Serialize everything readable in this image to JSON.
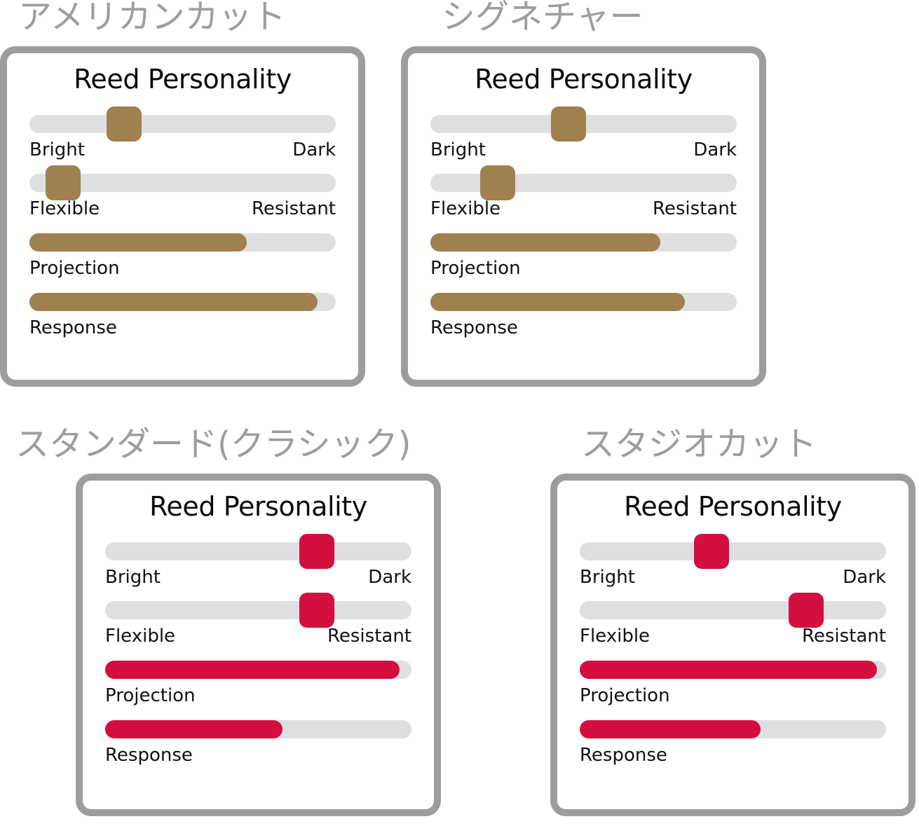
{
  "cards": [
    {
      "heading": "アメリカンカット",
      "title": "Reed Personality",
      "accent": "#a0804f",
      "controls": [
        {
          "type": "thumb",
          "value": 31,
          "left_label": "Bright",
          "right_label": "Dark"
        },
        {
          "type": "thumb",
          "value": 11,
          "left_label": "Flexible",
          "right_label": "Resistant"
        },
        {
          "type": "fill",
          "value": 71,
          "left_label": "Projection",
          "right_label": ""
        },
        {
          "type": "fill",
          "value": 94,
          "left_label": "Response",
          "right_label": ""
        }
      ]
    },
    {
      "heading": "シグネチャー",
      "title": "Reed Personality",
      "accent": "#a0804f",
      "controls": [
        {
          "type": "thumb",
          "value": 45,
          "left_label": "Bright",
          "right_label": "Dark"
        },
        {
          "type": "thumb",
          "value": 22,
          "left_label": "Flexible",
          "right_label": "Resistant"
        },
        {
          "type": "fill",
          "value": 75,
          "left_label": "Projection",
          "right_label": ""
        },
        {
          "type": "fill",
          "value": 83,
          "left_label": "Response",
          "right_label": ""
        }
      ]
    },
    {
      "heading": "スタンダード(クラシック)",
      "title": "Reed Personality",
      "accent": "#d30f3f",
      "controls": [
        {
          "type": "thumb",
          "value": 69,
          "left_label": "Bright",
          "right_label": "Dark"
        },
        {
          "type": "thumb",
          "value": 69,
          "left_label": "Flexible",
          "right_label": "Resistant"
        },
        {
          "type": "fill",
          "value": 96,
          "left_label": "Projection",
          "right_label": ""
        },
        {
          "type": "fill",
          "value": 58,
          "left_label": "Response",
          "right_label": ""
        }
      ]
    },
    {
      "heading": "スタジオカット",
      "title": "Reed Personality",
      "accent": "#d30f3f",
      "controls": [
        {
          "type": "thumb",
          "value": 43,
          "left_label": "Bright",
          "right_label": "Dark"
        },
        {
          "type": "thumb",
          "value": 74,
          "left_label": "Flexible",
          "right_label": "Resistant"
        },
        {
          "type": "fill",
          "value": 97,
          "left_label": "Projection",
          "right_label": ""
        },
        {
          "type": "fill",
          "value": 59,
          "left_label": "Response",
          "right_label": ""
        }
      ]
    }
  ],
  "colors": {
    "accent_tan": "#a0804f",
    "accent_red": "#d30f3f",
    "track_gray": "#dedfe1",
    "border_gray": "#9d9d9d",
    "heading_gray": "#9d9d9d",
    "text_black": "#111111",
    "background": "#ffffff"
  }
}
